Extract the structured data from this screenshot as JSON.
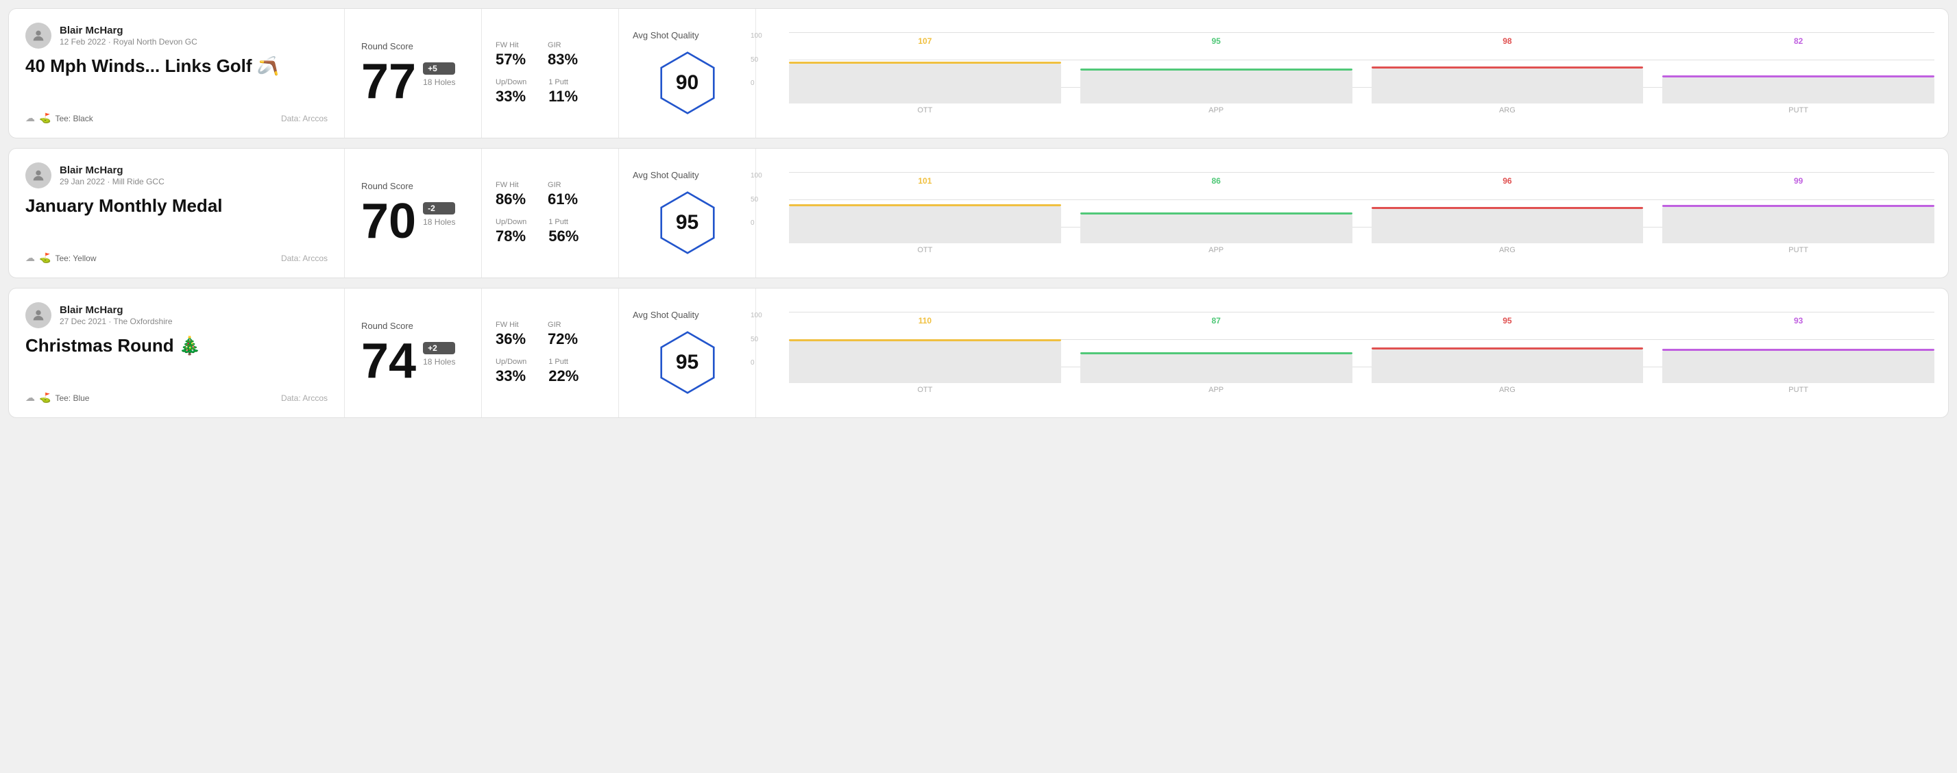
{
  "rounds": [
    {
      "id": "round-1",
      "player": {
        "name": "Blair McHarg",
        "date": "12 Feb 2022",
        "course": "Royal North Devon GC"
      },
      "title": "40 Mph Winds... Links Golf",
      "title_emoji": "🪃",
      "tee": "Black",
      "data_source": "Data: Arccos",
      "score": {
        "label": "Round Score",
        "number": "77",
        "badge": "+5",
        "holes": "18 Holes"
      },
      "stats": {
        "fw_hit_label": "FW Hit",
        "fw_hit_value": "57%",
        "gir_label": "GIR",
        "gir_value": "83%",
        "updown_label": "Up/Down",
        "updown_value": "33%",
        "oneputt_label": "1 Putt",
        "oneputt_value": "11%"
      },
      "quality": {
        "label": "Avg Shot Quality",
        "score": "90"
      },
      "chart": {
        "y_labels": [
          "100",
          "50",
          "0"
        ],
        "columns": [
          {
            "label": "OTT",
            "value": 107,
            "color": "#f0c040",
            "bar_pct": 72
          },
          {
            "label": "APP",
            "value": 95,
            "color": "#50c878",
            "bar_pct": 60
          },
          {
            "label": "ARG",
            "value": 98,
            "color": "#e05050",
            "bar_pct": 64
          },
          {
            "label": "PUTT",
            "value": 82,
            "color": "#c060e0",
            "bar_pct": 48
          }
        ]
      }
    },
    {
      "id": "round-2",
      "player": {
        "name": "Blair McHarg",
        "date": "29 Jan 2022",
        "course": "Mill Ride GCC"
      },
      "title": "January Monthly Medal",
      "title_emoji": "",
      "tee": "Yellow",
      "data_source": "Data: Arccos",
      "score": {
        "label": "Round Score",
        "number": "70",
        "badge": "-2",
        "holes": "18 Holes"
      },
      "stats": {
        "fw_hit_label": "FW Hit",
        "fw_hit_value": "86%",
        "gir_label": "GIR",
        "gir_value": "61%",
        "updown_label": "Up/Down",
        "updown_value": "78%",
        "oneputt_label": "1 Putt",
        "oneputt_value": "56%"
      },
      "quality": {
        "label": "Avg Shot Quality",
        "score": "95"
      },
      "chart": {
        "y_labels": [
          "100",
          "50",
          "0"
        ],
        "columns": [
          {
            "label": "OTT",
            "value": 101,
            "color": "#f0c040",
            "bar_pct": 68
          },
          {
            "label": "APP",
            "value": 86,
            "color": "#50c878",
            "bar_pct": 52
          },
          {
            "label": "ARG",
            "value": 96,
            "color": "#e05050",
            "bar_pct": 62
          },
          {
            "label": "PUTT",
            "value": 99,
            "color": "#c060e0",
            "bar_pct": 66
          }
        ]
      }
    },
    {
      "id": "round-3",
      "player": {
        "name": "Blair McHarg",
        "date": "27 Dec 2021",
        "course": "The Oxfordshire"
      },
      "title": "Christmas Round",
      "title_emoji": "🎄",
      "tee": "Blue",
      "data_source": "Data: Arccos",
      "score": {
        "label": "Round Score",
        "number": "74",
        "badge": "+2",
        "holes": "18 Holes"
      },
      "stats": {
        "fw_hit_label": "FW Hit",
        "fw_hit_value": "36%",
        "gir_label": "GIR",
        "gir_value": "72%",
        "updown_label": "Up/Down",
        "updown_value": "33%",
        "oneputt_label": "1 Putt",
        "oneputt_value": "22%"
      },
      "quality": {
        "label": "Avg Shot Quality",
        "score": "95"
      },
      "chart": {
        "y_labels": [
          "100",
          "50",
          "0"
        ],
        "columns": [
          {
            "label": "OTT",
            "value": 110,
            "color": "#f0c040",
            "bar_pct": 76
          },
          {
            "label": "APP",
            "value": 87,
            "color": "#50c878",
            "bar_pct": 53
          },
          {
            "label": "ARG",
            "value": 95,
            "color": "#e05050",
            "bar_pct": 61
          },
          {
            "label": "PUTT",
            "value": 93,
            "color": "#c060e0",
            "bar_pct": 59
          }
        ]
      }
    }
  ]
}
